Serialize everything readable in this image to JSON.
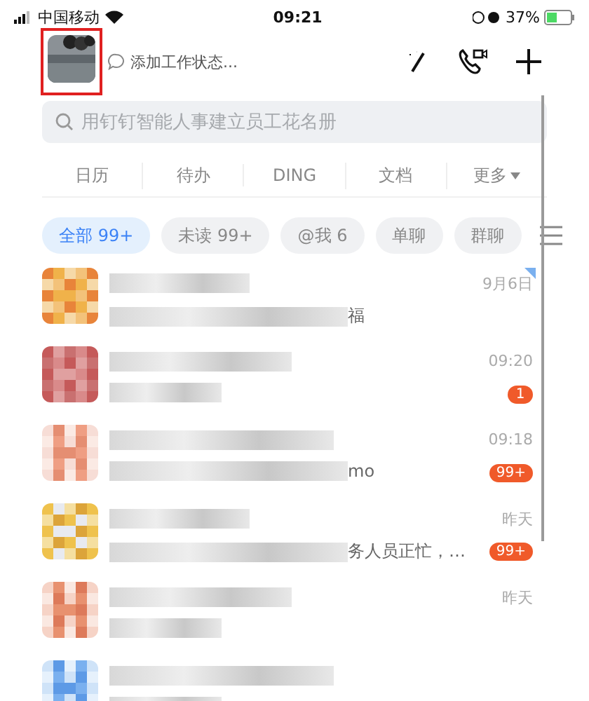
{
  "status_bar": {
    "carrier": "中国移动",
    "time": "09:21",
    "battery": "37%"
  },
  "header": {
    "status_placeholder": "添加工作状态...",
    "avatar_highlighted": true
  },
  "search": {
    "placeholder": "用钉钉智能人事建立员工花名册"
  },
  "shortcuts": [
    {
      "label": "日历",
      "dropdown": false
    },
    {
      "label": "待办",
      "dropdown": false
    },
    {
      "label": "DING",
      "dropdown": false
    },
    {
      "label": "文档",
      "dropdown": false
    },
    {
      "label": "更多",
      "dropdown": true
    }
  ],
  "filters": [
    {
      "label": "全部 99+",
      "selected": true
    },
    {
      "label": "未读 99+",
      "selected": false
    },
    {
      "label": "@我 6",
      "selected": false
    },
    {
      "label": "单聊",
      "selected": false
    },
    {
      "label": "群聊",
      "selected": false
    }
  ],
  "chats": [
    {
      "time": "9月6日",
      "snippet": "福",
      "pinned": true
    },
    {
      "time": "09:20",
      "badge": "1",
      "pinned": false
    },
    {
      "time": "09:18",
      "snippet": "mo",
      "badge": "99+",
      "pinned": false
    },
    {
      "time": "昨天",
      "snippet": "务人员正忙，…",
      "badge": "99+",
      "pinned": false
    },
    {
      "time": "昨天",
      "pinned": false
    },
    {
      "pinned": false
    }
  ]
}
